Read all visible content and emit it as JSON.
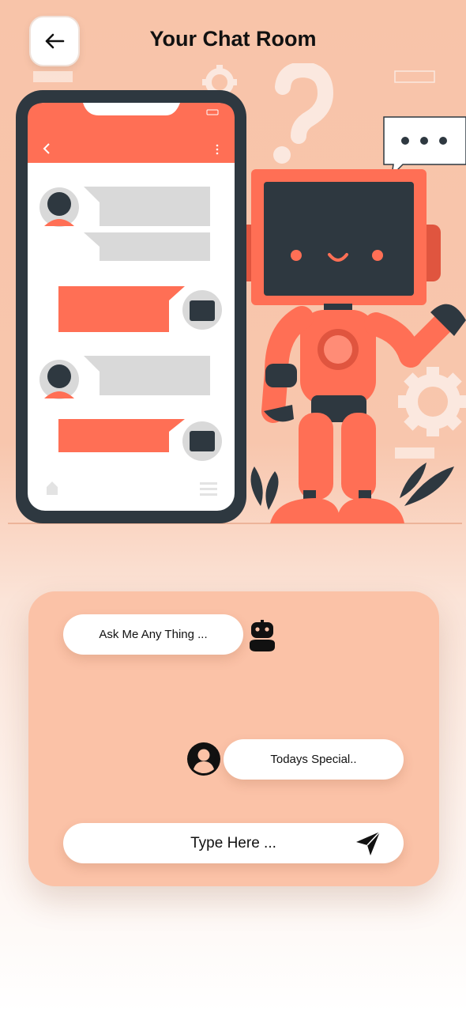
{
  "header": {
    "title": "Your Chat Room",
    "back_icon": "arrow-left-icon"
  },
  "illustration": {
    "description_icons": [
      "phone-mockup",
      "robot",
      "question-mark-icon",
      "gear-icon",
      "speech-bubble-ellipsis-icon",
      "leaf-plant-icon"
    ]
  },
  "chat": {
    "bot_message": "Ask Me Any Thing ...",
    "user_message": "Todays Special..",
    "input_placeholder": "Type Here ...",
    "bot_avatar_icon": "robot-icon",
    "user_avatar_icon": "user-circle-icon",
    "send_icon": "send-paper-plane-icon"
  },
  "colors": {
    "background": "#f8c4a9",
    "panel": "#fbc2a7",
    "accent": "#ff6f55",
    "dark": "#2e3840",
    "bubble": "#ffffff"
  }
}
